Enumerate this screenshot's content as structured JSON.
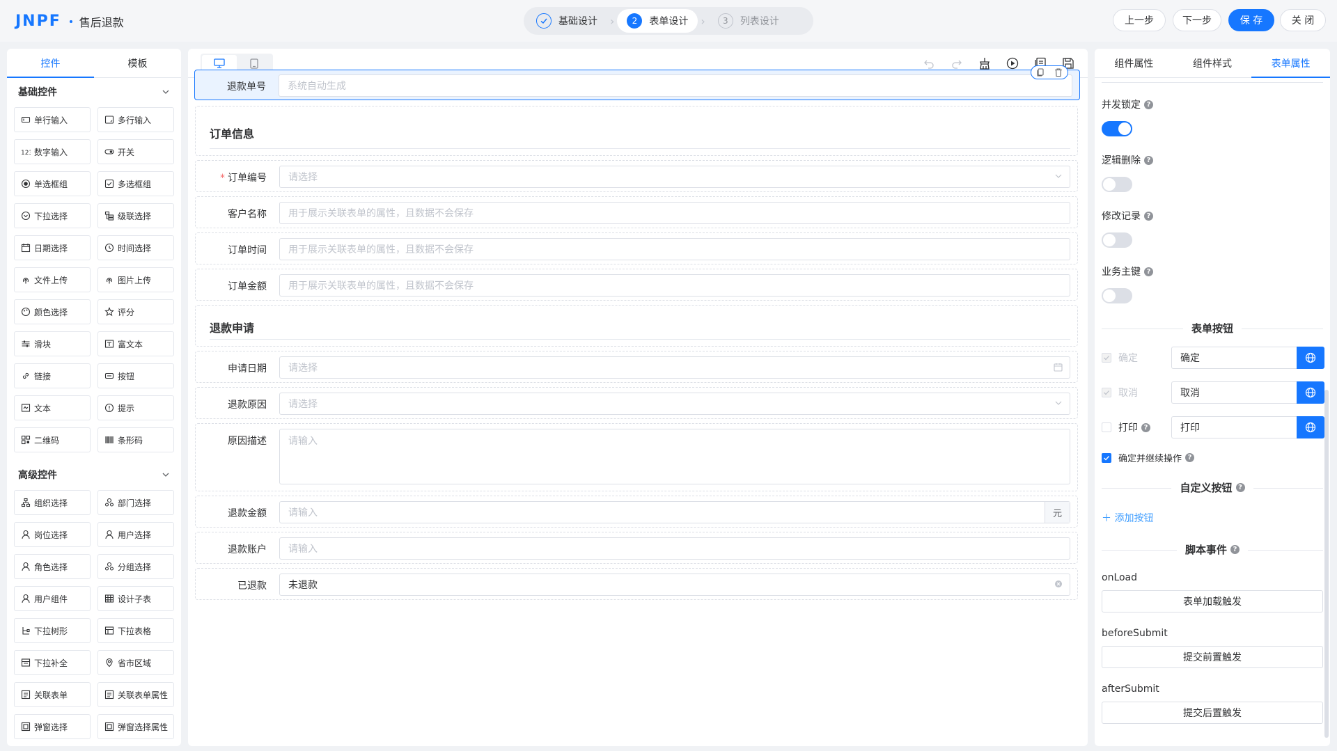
{
  "header": {
    "logo_text": "JNPF",
    "app_title": "售后退款",
    "steps": [
      {
        "num": "1",
        "label": "基础设计",
        "state": "done"
      },
      {
        "num": "2",
        "label": "表单设计",
        "state": "current"
      },
      {
        "num": "3",
        "label": "列表设计",
        "state": "todo"
      }
    ],
    "prev_label": "上一步",
    "next_label": "下一步",
    "save_label": "保 存",
    "close_label": "关 闭"
  },
  "left": {
    "tabs": [
      "控件",
      "模板"
    ],
    "basic_title": "基础控件",
    "basic": [
      {
        "label": "单行输入",
        "icon": "input-icon"
      },
      {
        "label": "多行输入",
        "icon": "textarea-icon"
      },
      {
        "label": "数字输入",
        "icon": "number-icon"
      },
      {
        "label": "开关",
        "icon": "switch-icon"
      },
      {
        "label": "单选框组",
        "icon": "radio-icon"
      },
      {
        "label": "多选框组",
        "icon": "checkbox-icon"
      },
      {
        "label": "下拉选择",
        "icon": "select-icon"
      },
      {
        "label": "级联选择",
        "icon": "cascader-icon"
      },
      {
        "label": "日期选择",
        "icon": "date-icon"
      },
      {
        "label": "时间选择",
        "icon": "time-icon"
      },
      {
        "label": "文件上传",
        "icon": "upload-icon"
      },
      {
        "label": "图片上传",
        "icon": "image-upload-icon"
      },
      {
        "label": "颜色选择",
        "icon": "color-icon"
      },
      {
        "label": "评分",
        "icon": "star-icon"
      },
      {
        "label": "滑块",
        "icon": "slider-icon"
      },
      {
        "label": "富文本",
        "icon": "richtext-icon"
      },
      {
        "label": "链接",
        "icon": "link-icon"
      },
      {
        "label": "按钮",
        "icon": "button-icon"
      },
      {
        "label": "文本",
        "icon": "text-icon"
      },
      {
        "label": "提示",
        "icon": "alert-icon"
      },
      {
        "label": "二维码",
        "icon": "qrcode-icon"
      },
      {
        "label": "条形码",
        "icon": "barcode-icon"
      }
    ],
    "advanced_title": "高级控件",
    "advanced": [
      {
        "label": "组织选择",
        "icon": "org-icon"
      },
      {
        "label": "部门选择",
        "icon": "dept-icon"
      },
      {
        "label": "岗位选择",
        "icon": "post-icon"
      },
      {
        "label": "用户选择",
        "icon": "user-icon"
      },
      {
        "label": "角色选择",
        "icon": "role-icon"
      },
      {
        "label": "分组选择",
        "icon": "group-icon"
      },
      {
        "label": "用户组件",
        "icon": "user-comp-icon"
      },
      {
        "label": "设计子表",
        "icon": "table-icon"
      },
      {
        "label": "下拉树形",
        "icon": "tree-icon"
      },
      {
        "label": "下拉表格",
        "icon": "dropdown-table-icon"
      },
      {
        "label": "下拉补全",
        "icon": "autocomplete-icon"
      },
      {
        "label": "省市区域",
        "icon": "location-icon"
      },
      {
        "label": "关联表单",
        "icon": "relation-form-icon"
      },
      {
        "label": "关联表单属性",
        "icon": "relation-attr-icon"
      },
      {
        "label": "弹窗选择",
        "icon": "popup-icon"
      },
      {
        "label": "弹窗选择属性",
        "icon": "popup-attr-icon"
      }
    ]
  },
  "form": {
    "refund_no": {
      "label": "退款单号",
      "placeholder": "系统自动生成"
    },
    "section1": "订单信息",
    "order_no": {
      "label": "订单编号",
      "placeholder": "请选择"
    },
    "customer": {
      "label": "客户名称",
      "placeholder": "用于展示关联表单的属性，且数据不会保存"
    },
    "order_time": {
      "label": "订单时间",
      "placeholder": "用于展示关联表单的属性，且数据不会保存"
    },
    "order_amount": {
      "label": "订单金额",
      "placeholder": "用于展示关联表单的属性，且数据不会保存"
    },
    "section2": "退款申请",
    "apply_date": {
      "label": "申请日期",
      "placeholder": "请选择"
    },
    "reason": {
      "label": "退款原因",
      "placeholder": "请选择"
    },
    "reason_desc": {
      "label": "原因描述",
      "placeholder": "请输入"
    },
    "refund_amount": {
      "label": "退款金额",
      "placeholder": "请输入",
      "unit": "元"
    },
    "refund_account": {
      "label": "退款账户",
      "placeholder": "请输入"
    },
    "refunded": {
      "label": "已退款",
      "value": "未退款"
    }
  },
  "right": {
    "tabs": [
      "组件属性",
      "组件样式",
      "表单属性"
    ],
    "concurrency_lock": {
      "label": "并发锁定",
      "on": true
    },
    "logic_delete": {
      "label": "逻辑删除",
      "on": false
    },
    "modify_record": {
      "label": "修改记录",
      "on": false
    },
    "business_key": {
      "label": "业务主键",
      "on": false
    },
    "form_buttons_title": "表单按钮",
    "buttons": [
      {
        "check_label": "确定",
        "value": "确定",
        "checked": true,
        "disabled": true
      },
      {
        "check_label": "取消",
        "value": "取消",
        "checked": true,
        "disabled": true
      },
      {
        "check_label": "打印",
        "value": "打印",
        "checked": false,
        "disabled": false
      }
    ],
    "confirm_continue": "确定并继续操作",
    "custom_buttons_title": "自定义按钮",
    "add_button": "添加按钮",
    "script_events_title": "脚本事件",
    "events": [
      {
        "name": "onLoad",
        "button": "表单加载触发"
      },
      {
        "name": "beforeSubmit",
        "button": "提交前置触发"
      },
      {
        "name": "afterSubmit",
        "button": "提交后置触发"
      }
    ]
  },
  "colors": {
    "primary": "#1677ff",
    "required": "#f56c6c"
  }
}
